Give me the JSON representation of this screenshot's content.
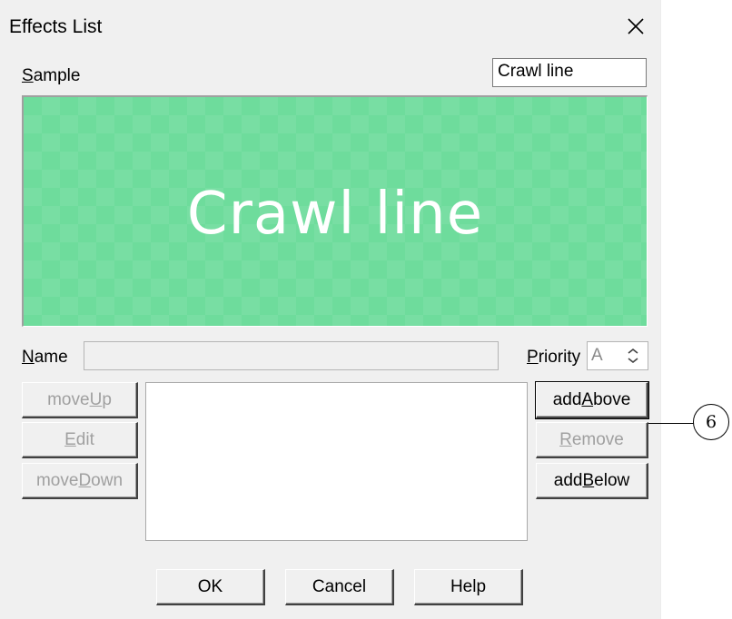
{
  "window": {
    "title": "Effects List"
  },
  "sample": {
    "label_mnemonic": "S",
    "label_rest": "ample",
    "value": "Crawl line"
  },
  "preview": {
    "text": "Crawl line",
    "background_color": "#6edc9c"
  },
  "name_row": {
    "label_mnemonic": "N",
    "label_rest": "ame",
    "value": ""
  },
  "priority": {
    "label_mnemonic": "P",
    "label_rest": "riority",
    "value": "A"
  },
  "left_buttons": {
    "move_up": {
      "prefix": "move ",
      "mnemonic": "U",
      "suffix": "p"
    },
    "edit": {
      "prefix": "",
      "mnemonic": "E",
      "suffix": "dit"
    },
    "move_down": {
      "prefix": "move ",
      "mnemonic": "D",
      "suffix": "own"
    }
  },
  "right_buttons": {
    "add_above": {
      "prefix": "add ",
      "mnemonic": "A",
      "suffix": "bove"
    },
    "remove": {
      "prefix": "",
      "mnemonic": "R",
      "suffix": "emove"
    },
    "add_below": {
      "prefix": "add ",
      "mnemonic": "B",
      "suffix": "elow"
    }
  },
  "footer": {
    "ok": "OK",
    "cancel": "Cancel",
    "help": "Help"
  },
  "callout": {
    "number": "6"
  }
}
